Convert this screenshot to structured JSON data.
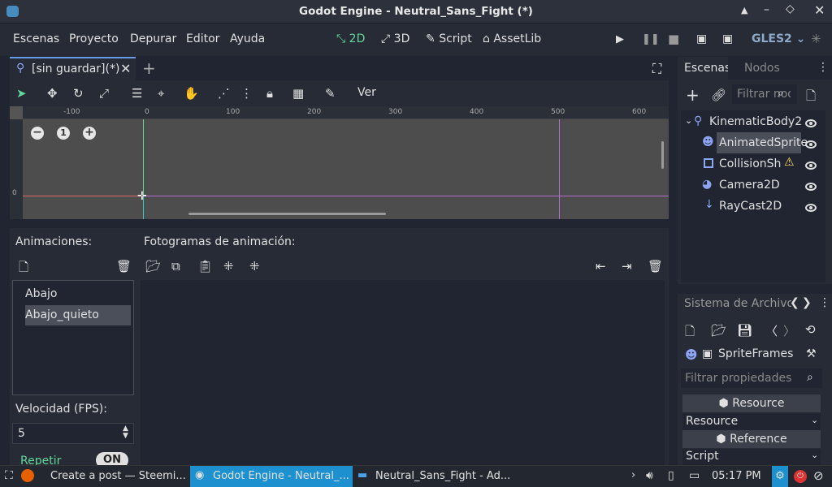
{
  "window": {
    "title": "Godot Engine - Neutral_Sans_Fight (*)"
  },
  "menu": {
    "items": [
      "Escenas",
      "Proyecto",
      "Depurar",
      "Editor",
      "Ayuda"
    ]
  },
  "modes": {
    "d2": "2D",
    "d3": "3D",
    "script": "Script",
    "assetlib": "AssetLib"
  },
  "renderer": "GLES2",
  "scene_tab": {
    "label": "[sin guardar](*)"
  },
  "toolbar2d": {
    "view_label": "Ver"
  },
  "ruler": {
    "ticks": [
      "-100",
      "0",
      "100",
      "200",
      "300",
      "400",
      "500",
      "600"
    ],
    "vtick": "0"
  },
  "viewport": {
    "zoom_reset": "1"
  },
  "animations": {
    "header": "Animaciones:",
    "frames_header": "Fotogramas de animación:",
    "list": [
      "Abajo",
      "Abajo_quieto"
    ],
    "selected": "Abajo_quieto",
    "speed_label": "Velocidad (FPS):",
    "speed_value": "5",
    "loop_label": "Repetir",
    "loop_state": "ON"
  },
  "scene_dock": {
    "tab_scenes": "Escenas",
    "tab_nodes": "Nodos",
    "filter_placeholder": "Filtrar nodos",
    "nodes": [
      {
        "name": "KinematicBody2",
        "icon": "kinematic-icon"
      },
      {
        "name": "AnimatedSprite",
        "icon": "animated-sprite-icon"
      },
      {
        "name": "CollisionSh",
        "icon": "collision-shape-icon"
      },
      {
        "name": "Camera2D",
        "icon": "camera-icon"
      },
      {
        "name": "RayCast2D",
        "icon": "raycast-icon"
      }
    ]
  },
  "file_dock": {
    "title": "Sistema de Archivos",
    "resource_name": "SpriteFrames",
    "filter_placeholder": "Filtrar propiedades",
    "sections": [
      {
        "header": "Resource",
        "value": "Resource"
      },
      {
        "header": "Reference",
        "value": "Script"
      }
    ]
  },
  "taskbar": {
    "items": [
      "Create a post — Steemi...",
      "Godot Engine - Neutral_...",
      "Neutral_Sans_Fight - Ad..."
    ],
    "clock": "05:17 PM"
  },
  "colors": {
    "accent_green": "#62d79b",
    "accent_blue": "#699ce8",
    "warning": "#ffdd65"
  }
}
